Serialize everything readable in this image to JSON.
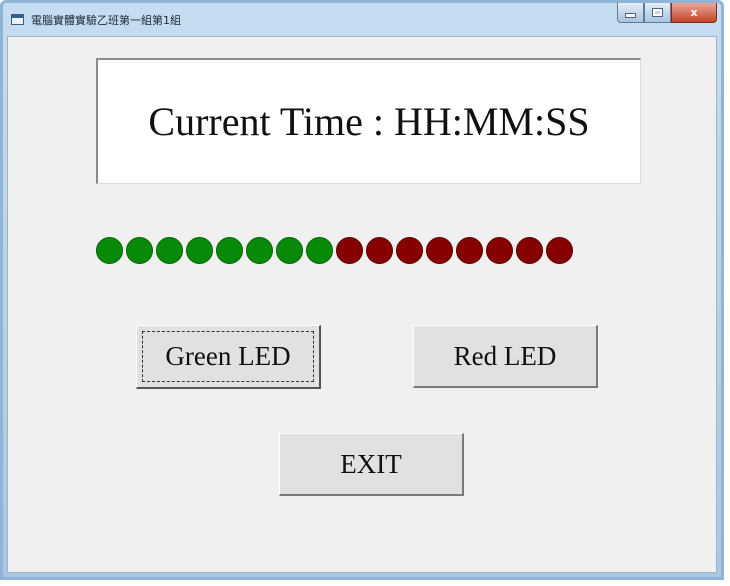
{
  "window": {
    "title": "電腦實體實驗乙班第一組第1組",
    "controls": {
      "minimize_icon": "minimize-icon",
      "maximize_icon": "maximize-icon",
      "close_label": "x"
    }
  },
  "display": {
    "time_text": "Current Time : HH:MM:SS"
  },
  "leds": {
    "green_count": 8,
    "red_count": 8,
    "green_color": "#078a07",
    "red_color": "#860000"
  },
  "buttons": {
    "green_led_label": "Green LED",
    "red_led_label": "Red LED",
    "exit_label": "EXIT"
  },
  "colors": {
    "client_background": "#f0f0f0",
    "display_background": "#ffffff",
    "title_bar": "#a9c8e6",
    "close_button": "#c4442a"
  }
}
